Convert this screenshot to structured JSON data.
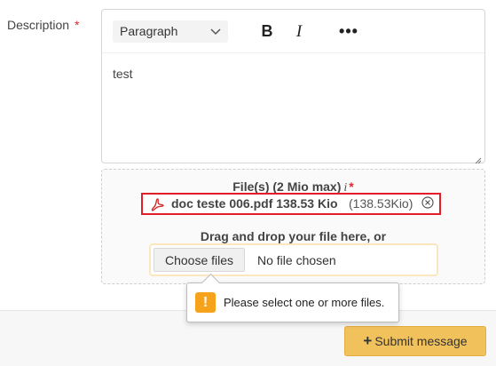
{
  "description": {
    "label": "Description",
    "required_mark": "*"
  },
  "editor": {
    "paragraph_select": "Paragraph",
    "bold_label": "B",
    "italic_label": "I",
    "more_label": "•••",
    "content": "test"
  },
  "upload": {
    "files_label": "File(s) (2 Mio max)",
    "info_mark": "i",
    "required_mark": "*",
    "file": {
      "name": "doc teste 006.pdf 138.53 Kio",
      "size": "(138.53Kio)"
    },
    "drag_text": "Drag and drop your file here, or",
    "choose_label": "Choose files",
    "no_file_label": "No file chosen"
  },
  "tooltip": {
    "icon_text": "!",
    "text": "Please select one or more files."
  },
  "submit": {
    "plus": "+",
    "label": "Submit message"
  },
  "colors": {
    "required": "#d9282f",
    "file_highlight_border": "#e21f26",
    "submit_bg": "#f1c15c",
    "warning": "#f6a21a"
  },
  "icons": {
    "chevron": "chevron-down-icon",
    "pdf": "pdf-icon",
    "remove": "close-circle-icon",
    "warning": "warning-icon",
    "resize": "resize-grip-icon"
  }
}
